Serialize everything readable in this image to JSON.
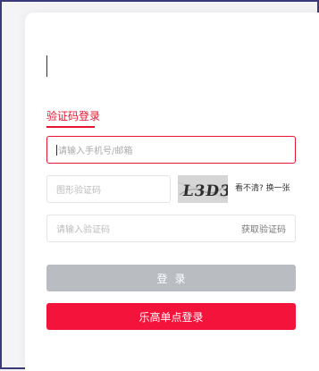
{
  "tabs": {
    "active_label": "验证码登录"
  },
  "form": {
    "phone_placeholder": "请输入手机号/邮箱",
    "image_code_placeholder": "图形验证码",
    "captcha_text": "L3D3",
    "refresh_label": "看不清? 换一张",
    "sms_code_placeholder": "请输入验证码",
    "get_code_label": "获取验证码"
  },
  "buttons": {
    "login_label": "登录",
    "sso_label": "乐高单点登录"
  },
  "colors": {
    "accent": "#e5162f",
    "sso_button": "#f4133a",
    "login_button_disabled": "#b9bcc1"
  }
}
